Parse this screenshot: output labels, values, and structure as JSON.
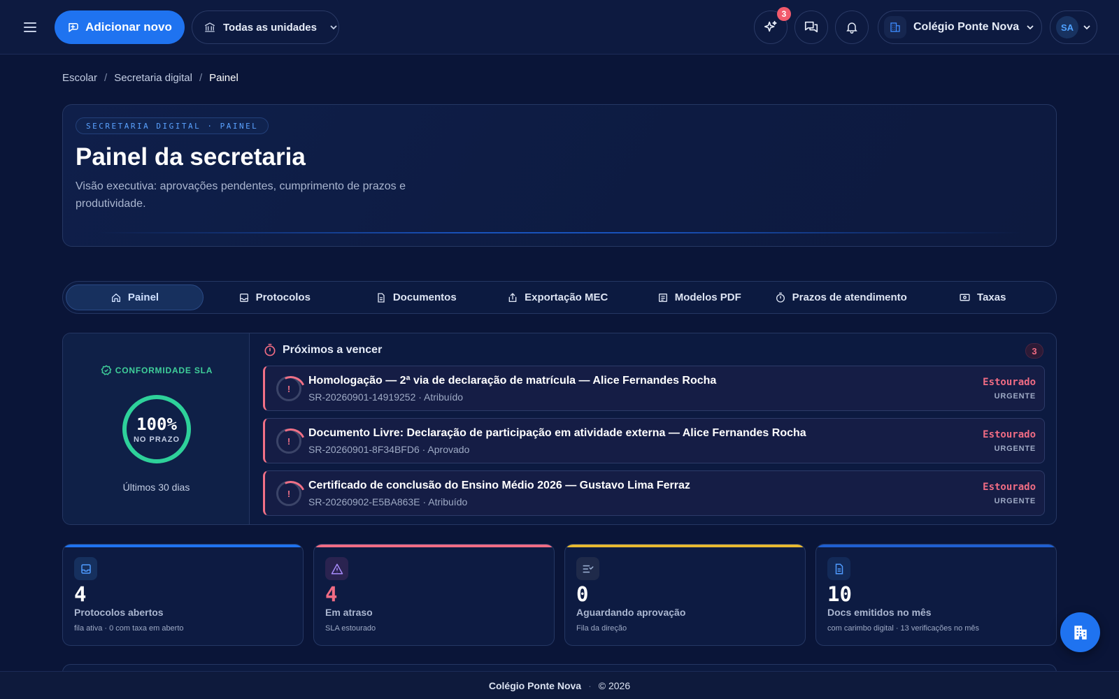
{
  "topbar": {
    "add_button": "Adicionar novo",
    "unit_select": "Todas as unidades",
    "ai_badge": "3",
    "school": "Colégio Ponte Nova",
    "user_initials": "SA"
  },
  "breadcrumb": [
    "Escolar",
    "Secretaria digital",
    "Painel"
  ],
  "hero": {
    "tag": "SECRETARIA DIGITAL · PAINEL",
    "title": "Painel da secretaria",
    "description": "Visão executiva: aprovações pendentes, cumprimento de prazos e produtividade."
  },
  "tabs": [
    {
      "label": "Painel",
      "icon": "home-icon",
      "active": true
    },
    {
      "label": "Protocolos",
      "icon": "inbox-icon"
    },
    {
      "label": "Documentos",
      "icon": "document-icon"
    },
    {
      "label": "Exportação MEC",
      "icon": "upload-icon"
    },
    {
      "label": "Modelos PDF",
      "icon": "template-icon"
    },
    {
      "label": "Prazos de atendimento",
      "icon": "timer-icon"
    },
    {
      "label": "Taxas",
      "icon": "money-icon"
    }
  ],
  "sla": {
    "label": "CONFORMIDADE SLA",
    "percent": "100%",
    "sub": "NO PRAZO",
    "period": "Últimos 30 dias",
    "color": "#2ed19a"
  },
  "upcoming": {
    "title": "Próximos a vencer",
    "count": "3",
    "items": [
      {
        "title": "Homologação — 2ª via de declaração de matrícula — Alice Fernandes Rocha",
        "meta": "SR-20260901-14919252 · Atribuído",
        "status": "Estourado",
        "priority": "URGENTE"
      },
      {
        "title": "Documento Livre: Declaração de participação em atividade externa — Alice Fernandes Rocha",
        "meta": "SR-20260901-8F34BFD6 · Aprovado",
        "status": "Estourado",
        "priority": "URGENTE"
      },
      {
        "title": "Certificado de conclusão do Ensino Médio 2026 — Gustavo Lima Ferraz",
        "meta": "SR-20260902-E5BA863E · Atribuído",
        "status": "Estourado",
        "priority": "URGENTE"
      }
    ]
  },
  "stats": [
    {
      "value": "4",
      "label": "Protocolos abertos",
      "sub": "fila ativa · 0 com taxa em aberto",
      "color": "#1f73f0",
      "icon": "inbox-icon"
    },
    {
      "value": "4",
      "label": "Em atraso",
      "sub": "SLA estourado",
      "color": "#f06c84",
      "icon": "warning-icon"
    },
    {
      "value": "0",
      "label": "Aguardando aprovação",
      "sub": "Fila da direção",
      "color": "#e8b931",
      "icon": "approval-list-icon"
    },
    {
      "value": "10",
      "label": "Docs emitidos no mês",
      "sub": "com carimbo digital · 13 verificações no mês",
      "color": "#1f5fd0",
      "icon": "document-icon"
    }
  ],
  "footer": {
    "brand": "Colégio Ponte Nova",
    "copyright": "© 2026"
  }
}
